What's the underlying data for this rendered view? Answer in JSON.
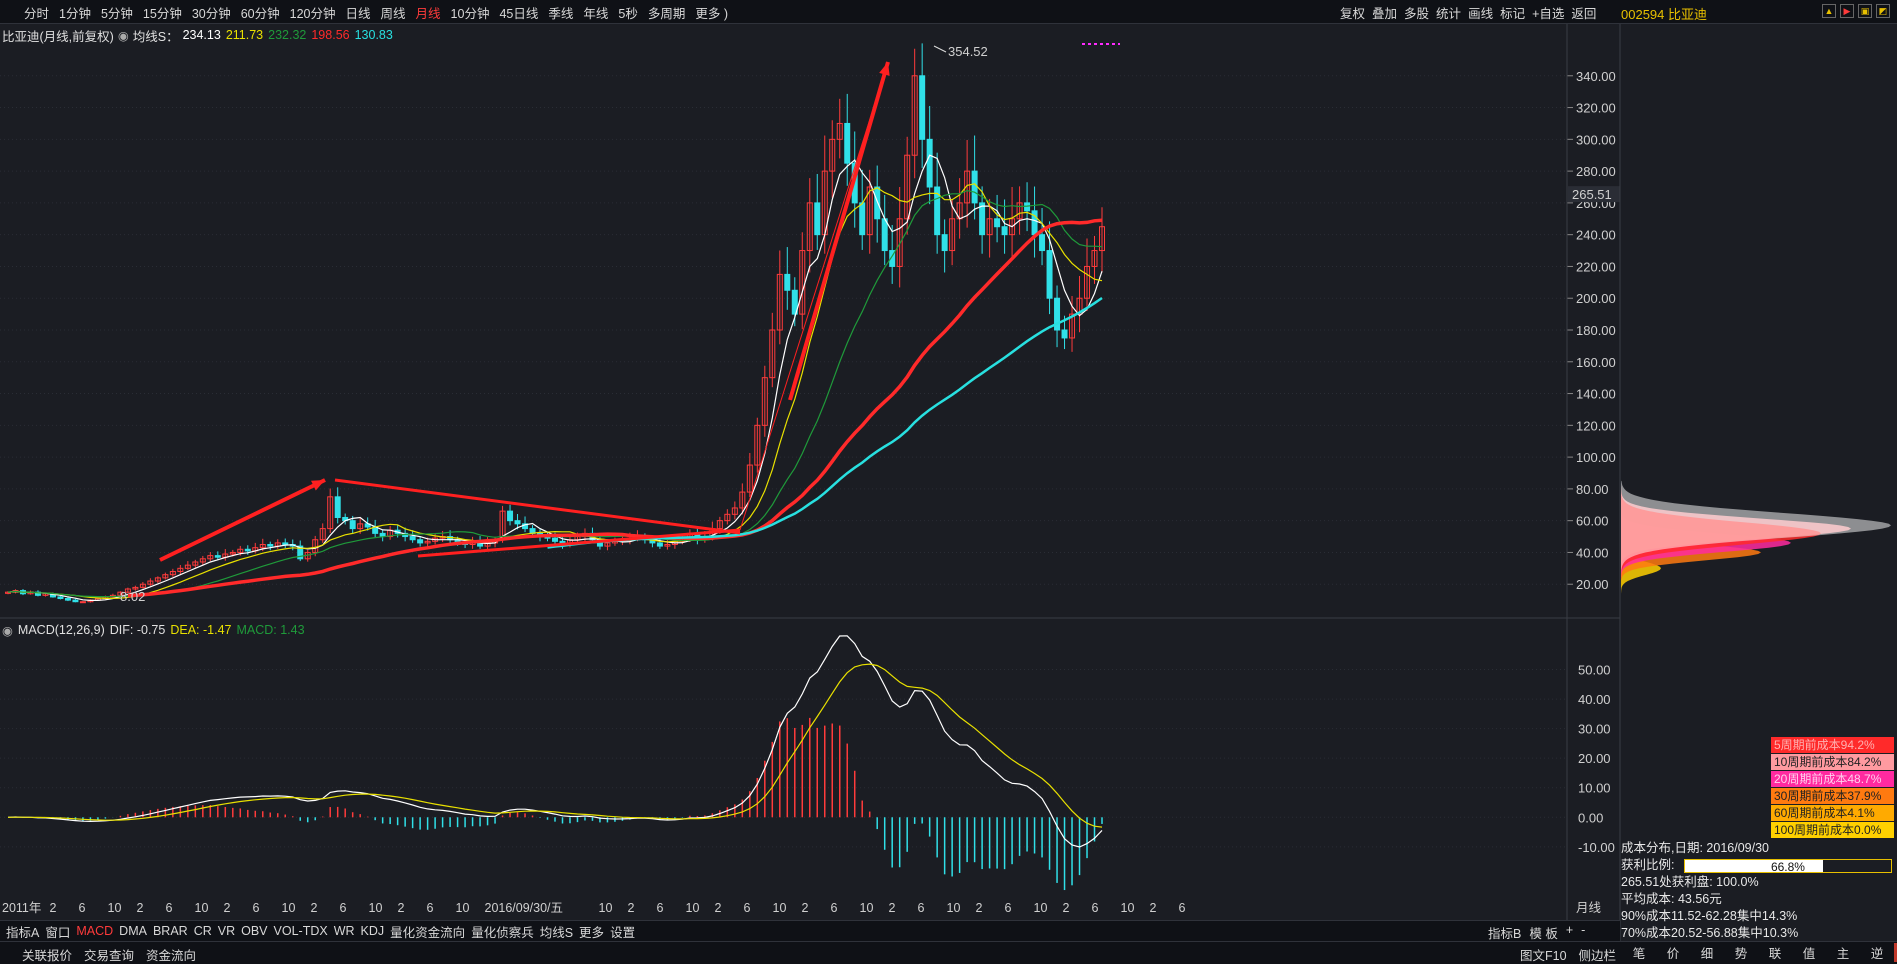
{
  "toolbar": {
    "periods": [
      "分时",
      "1分钟",
      "5分钟",
      "15分钟",
      "30分钟",
      "60分钟",
      "120分钟",
      "日线",
      "周线",
      "月线",
      "10分钟",
      "45日线",
      "季线",
      "年线",
      "5秒",
      "多周期",
      "更多 )"
    ],
    "active_period": "月线",
    "right_tools": [
      "复权",
      "叠加",
      "多股",
      "统计",
      "画线",
      "标记",
      "+自选",
      "返回"
    ]
  },
  "stock": {
    "label": "002594 比亚迪"
  },
  "main_header": {
    "name": "比亚迪(月线,前复权)",
    "ma_label": "均线S：",
    "ma_values": [
      {
        "value": "234.13",
        "color": "#ffffff"
      },
      {
        "value": "211.73",
        "color": "#e8e000"
      },
      {
        "value": "232.32",
        "color": "#1f9a3a"
      },
      {
        "value": "198.56",
        "color": "#ff2a2a"
      },
      {
        "value": "130.83",
        "color": "#28e0e0"
      }
    ]
  },
  "macd_header": {
    "name": "MACD(12,26,9)",
    "dif": "DIF: -0.75",
    "dea": "DEA: -1.47",
    "macd": "MACD: 1.43"
  },
  "chart_data": [
    {
      "type": "candlestick",
      "title": "比亚迪(月线,前复权)",
      "price_axis": {
        "ticks": [
          20,
          40,
          60,
          80,
          100,
          120,
          140,
          160,
          180,
          200,
          220,
          240,
          260,
          280,
          300,
          320,
          340
        ],
        "labels": [
          "20.00",
          "40.00",
          "60.00",
          "80.00",
          "100.00",
          "120.00",
          "140.00",
          "160.00",
          "180.00",
          "200.00",
          "220.00",
          "240.00",
          "260.00",
          "280.00",
          "300.00",
          "320.00",
          "340.00"
        ],
        "range": [
          0,
          360
        ]
      },
      "current_price": "265.51",
      "annotations": {
        "high": "354.52",
        "low": "8.02"
      },
      "time_axis": {
        "labels": [
          "2011年",
          "2",
          "6",
          "10",
          "2",
          "6",
          "10",
          "2",
          "6",
          "10",
          "2",
          "6",
          "10",
          "2",
          "6",
          "10",
          "2016/09/30/五",
          "10",
          "2",
          "6",
          "10",
          "2",
          "6",
          "10",
          "2",
          "6",
          "10",
          "2",
          "6",
          "10",
          "2",
          "6",
          "10",
          "2",
          "6",
          "10",
          "2",
          "6"
        ],
        "right_label": "月线"
      },
      "candles_close": [
        15,
        16,
        14,
        15,
        13,
        14,
        12,
        11,
        10,
        9,
        9,
        10,
        11,
        12,
        13,
        15,
        17,
        18,
        20,
        22,
        24,
        26,
        28,
        30,
        32,
        34,
        36,
        38,
        37,
        39,
        40,
        42,
        41,
        43,
        45,
        44,
        46,
        45,
        44,
        36,
        40,
        48,
        55,
        75,
        62,
        60,
        55,
        58,
        56,
        52,
        50,
        54,
        52,
        50,
        48,
        46,
        47,
        49,
        50,
        48,
        46,
        45,
        47,
        44,
        46,
        48,
        66,
        60,
        58,
        55,
        52,
        50,
        49,
        47,
        45,
        48,
        50,
        52,
        48,
        44,
        46,
        47,
        48,
        49,
        50,
        48,
        46,
        44,
        45,
        47,
        49,
        52,
        48,
        50,
        55,
        60,
        64,
        68,
        78,
        95,
        120,
        150,
        180,
        215,
        205,
        190,
        230,
        260,
        240,
        280,
        300,
        310,
        285,
        260,
        240,
        270,
        250,
        230,
        220,
        250,
        290,
        340,
        300,
        270,
        240,
        230,
        250,
        260,
        280,
        260,
        240,
        250,
        245,
        240,
        250,
        260,
        255,
        240,
        230,
        200,
        180,
        175,
        190,
        200,
        220,
        230,
        245
      ],
      "ma_series": [
        {
          "name": "MA1",
          "color": "#ffffff"
        },
        {
          "name": "MA2",
          "color": "#e8e000"
        },
        {
          "name": "MA3",
          "color": "#1f9a3a"
        },
        {
          "name": "MA4",
          "color": "#ff2a2a"
        },
        {
          "name": "MA5",
          "color": "#28e0e0"
        }
      ]
    },
    {
      "type": "line",
      "title": "MACD(12,26,9)",
      "axis": {
        "ticks": [
          -10,
          0,
          10,
          20,
          30,
          40,
          50
        ],
        "labels": [
          "-10.00",
          "0.00",
          "10.00",
          "20.00",
          "30.00",
          "40.00",
          "50.00"
        ],
        "range": [
          -28,
          60
        ]
      },
      "series": [
        {
          "name": "DIF",
          "color": "#ffffff"
        },
        {
          "name": "DEA",
          "color": "#e8e000"
        },
        {
          "name": "MACD",
          "color": "#1f9a3a"
        }
      ]
    },
    {
      "type": "bar",
      "title": "成本分布",
      "price_range": [
        0,
        360
      ]
    }
  ],
  "cost_legend": [
    {
      "label": "5周期前成本94.2%",
      "bg": "#ff2a2a",
      "fg": "#ffb0b0"
    },
    {
      "label": "10周期前成本84.2%",
      "bg": "#ff9aa0",
      "fg": "#222"
    },
    {
      "label": "20周期前成本48.7%",
      "bg": "#ff2aa0",
      "fg": "#ffd0ee"
    },
    {
      "label": "30周期前成本37.9%",
      "bg": "#ff7a10",
      "fg": "#222"
    },
    {
      "label": "60周期前成本4.1%",
      "bg": "#ffaa00",
      "fg": "#222"
    },
    {
      "label": "100周期前成本0.0%",
      "bg": "#ffd000",
      "fg": "#222"
    }
  ],
  "cost_info": {
    "title": "成本分布,日期: 2016/09/30",
    "profit_label": "获利比例:",
    "profit_value": "66.8%",
    "profit_fraction": 0.668,
    "line1": "265.51处获利盘: 100.0%",
    "line2": "平均成本: 43.56元",
    "line3": "90%成本11.52-62.28集中14.3%",
    "line4": "70%成本20.52-56.88集中10.3%"
  },
  "indicator_tabs": [
    "指标A",
    "窗口",
    "MACD",
    "DMA",
    "BRAR",
    "CR",
    "VR",
    "OBV",
    "VOL-TDX",
    "WR",
    "KDJ",
    "量化资金流向",
    "量化侦察兵",
    "均线S",
    "更多",
    "设置"
  ],
  "active_indicator": "MACD",
  "indicator_right": [
    "指标B",
    "模 板",
    "+",
    "-"
  ],
  "bottom_tabs": [
    "关联报价",
    "交易查询",
    "资金流向"
  ],
  "bottom_right": [
    "图文F10",
    "侧边栏"
  ],
  "side_tabs": [
    "笔",
    "价",
    "细",
    "势",
    "联",
    "值",
    "主",
    "逆",
    "筹"
  ],
  "active_side": "筹",
  "colors": {
    "up": "#ff3b3b",
    "down": "#30e0e8",
    "bg": "#1b1d23",
    "grid": "#2a2d35"
  }
}
